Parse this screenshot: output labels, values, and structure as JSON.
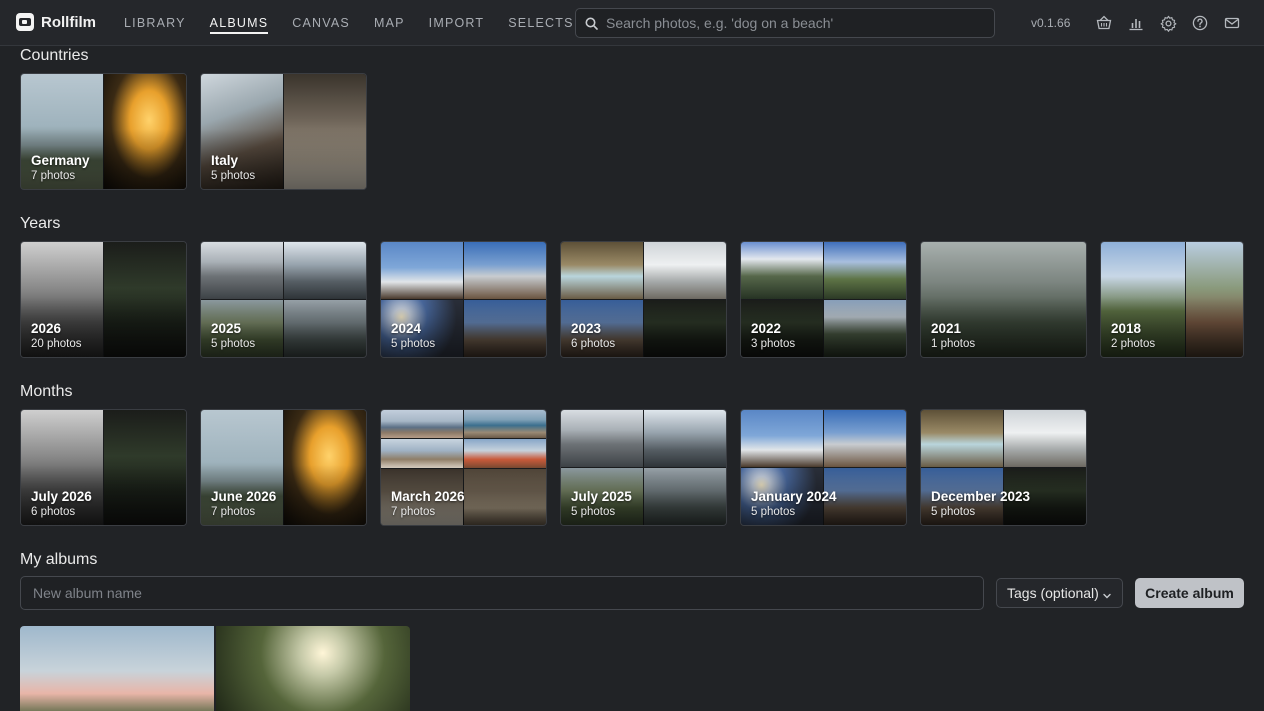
{
  "app": {
    "name": "Rollfilm",
    "version": "v0.1.66"
  },
  "nav": {
    "items": [
      {
        "label": "LIBRARY",
        "active": false
      },
      {
        "label": "ALBUMS",
        "active": true
      },
      {
        "label": "CANVAS",
        "active": false
      },
      {
        "label": "MAP",
        "active": false
      },
      {
        "label": "IMPORT",
        "active": false
      },
      {
        "label": "SELECTS",
        "active": false
      }
    ]
  },
  "search": {
    "placeholder": "Search photos, e.g. 'dog on a beach'",
    "value": ""
  },
  "toolbar_icons": [
    "basket-icon",
    "stats-icon",
    "gear-icon",
    "help-icon",
    "mail-icon"
  ],
  "sections": {
    "countries": {
      "title": "Countries",
      "albums": [
        {
          "name": "Germany",
          "count": "7 photos"
        },
        {
          "name": "Italy",
          "count": "5 photos"
        }
      ]
    },
    "years": {
      "title": "Years",
      "albums": [
        {
          "name": "2026",
          "count": "20 photos"
        },
        {
          "name": "2025",
          "count": "5 photos"
        },
        {
          "name": "2024",
          "count": "5 photos"
        },
        {
          "name": "2023",
          "count": "6 photos"
        },
        {
          "name": "2022",
          "count": "3 photos"
        },
        {
          "name": "2021",
          "count": "1 photos"
        },
        {
          "name": "2018",
          "count": "2 photos"
        }
      ]
    },
    "months": {
      "title": "Months",
      "albums": [
        {
          "name": "July 2026",
          "count": "6 photos"
        },
        {
          "name": "June 2026",
          "count": "7 photos"
        },
        {
          "name": "March 2026",
          "count": "7 photos"
        },
        {
          "name": "July 2025",
          "count": "5 photos"
        },
        {
          "name": "January 2024",
          "count": "5 photos"
        },
        {
          "name": "December 2023",
          "count": "5 photos"
        }
      ]
    },
    "my_albums": {
      "title": "My albums",
      "new_album_placeholder": "New album name",
      "new_album_value": "",
      "tags_label": "Tags (optional)",
      "create_label": "Create album"
    }
  },
  "colors": {
    "background": "#212326",
    "topbar": "#25272b",
    "accent_button": "#bfc2c7"
  }
}
